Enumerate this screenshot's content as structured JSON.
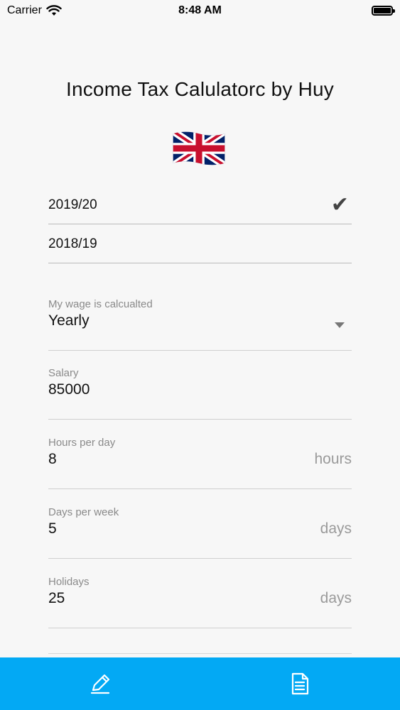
{
  "status_bar": {
    "carrier": "Carrier",
    "time": "8:48 AM"
  },
  "app": {
    "title": "Income Tax Calulatorc by Huy",
    "flag_icon": "uk-flag-icon"
  },
  "tax_years": [
    {
      "label": "2019/20",
      "selected": true
    },
    {
      "label": "2018/19",
      "selected": false
    }
  ],
  "form": {
    "wage_period": {
      "label": "My wage is calcualted",
      "value": "Yearly"
    },
    "salary": {
      "label": "Salary",
      "value": "85000"
    },
    "hours_per_day": {
      "label": "Hours per day",
      "value": "8",
      "suffix": "hours"
    },
    "days_per_week": {
      "label": "Days per week",
      "value": "5",
      "suffix": "days"
    },
    "holidays": {
      "label": "Holidays",
      "value": "25",
      "suffix": "days"
    }
  },
  "tab_bar": {
    "color": "#03a9f4",
    "tabs": [
      {
        "icon": "pencil-icon"
      },
      {
        "icon": "document-icon"
      }
    ]
  }
}
